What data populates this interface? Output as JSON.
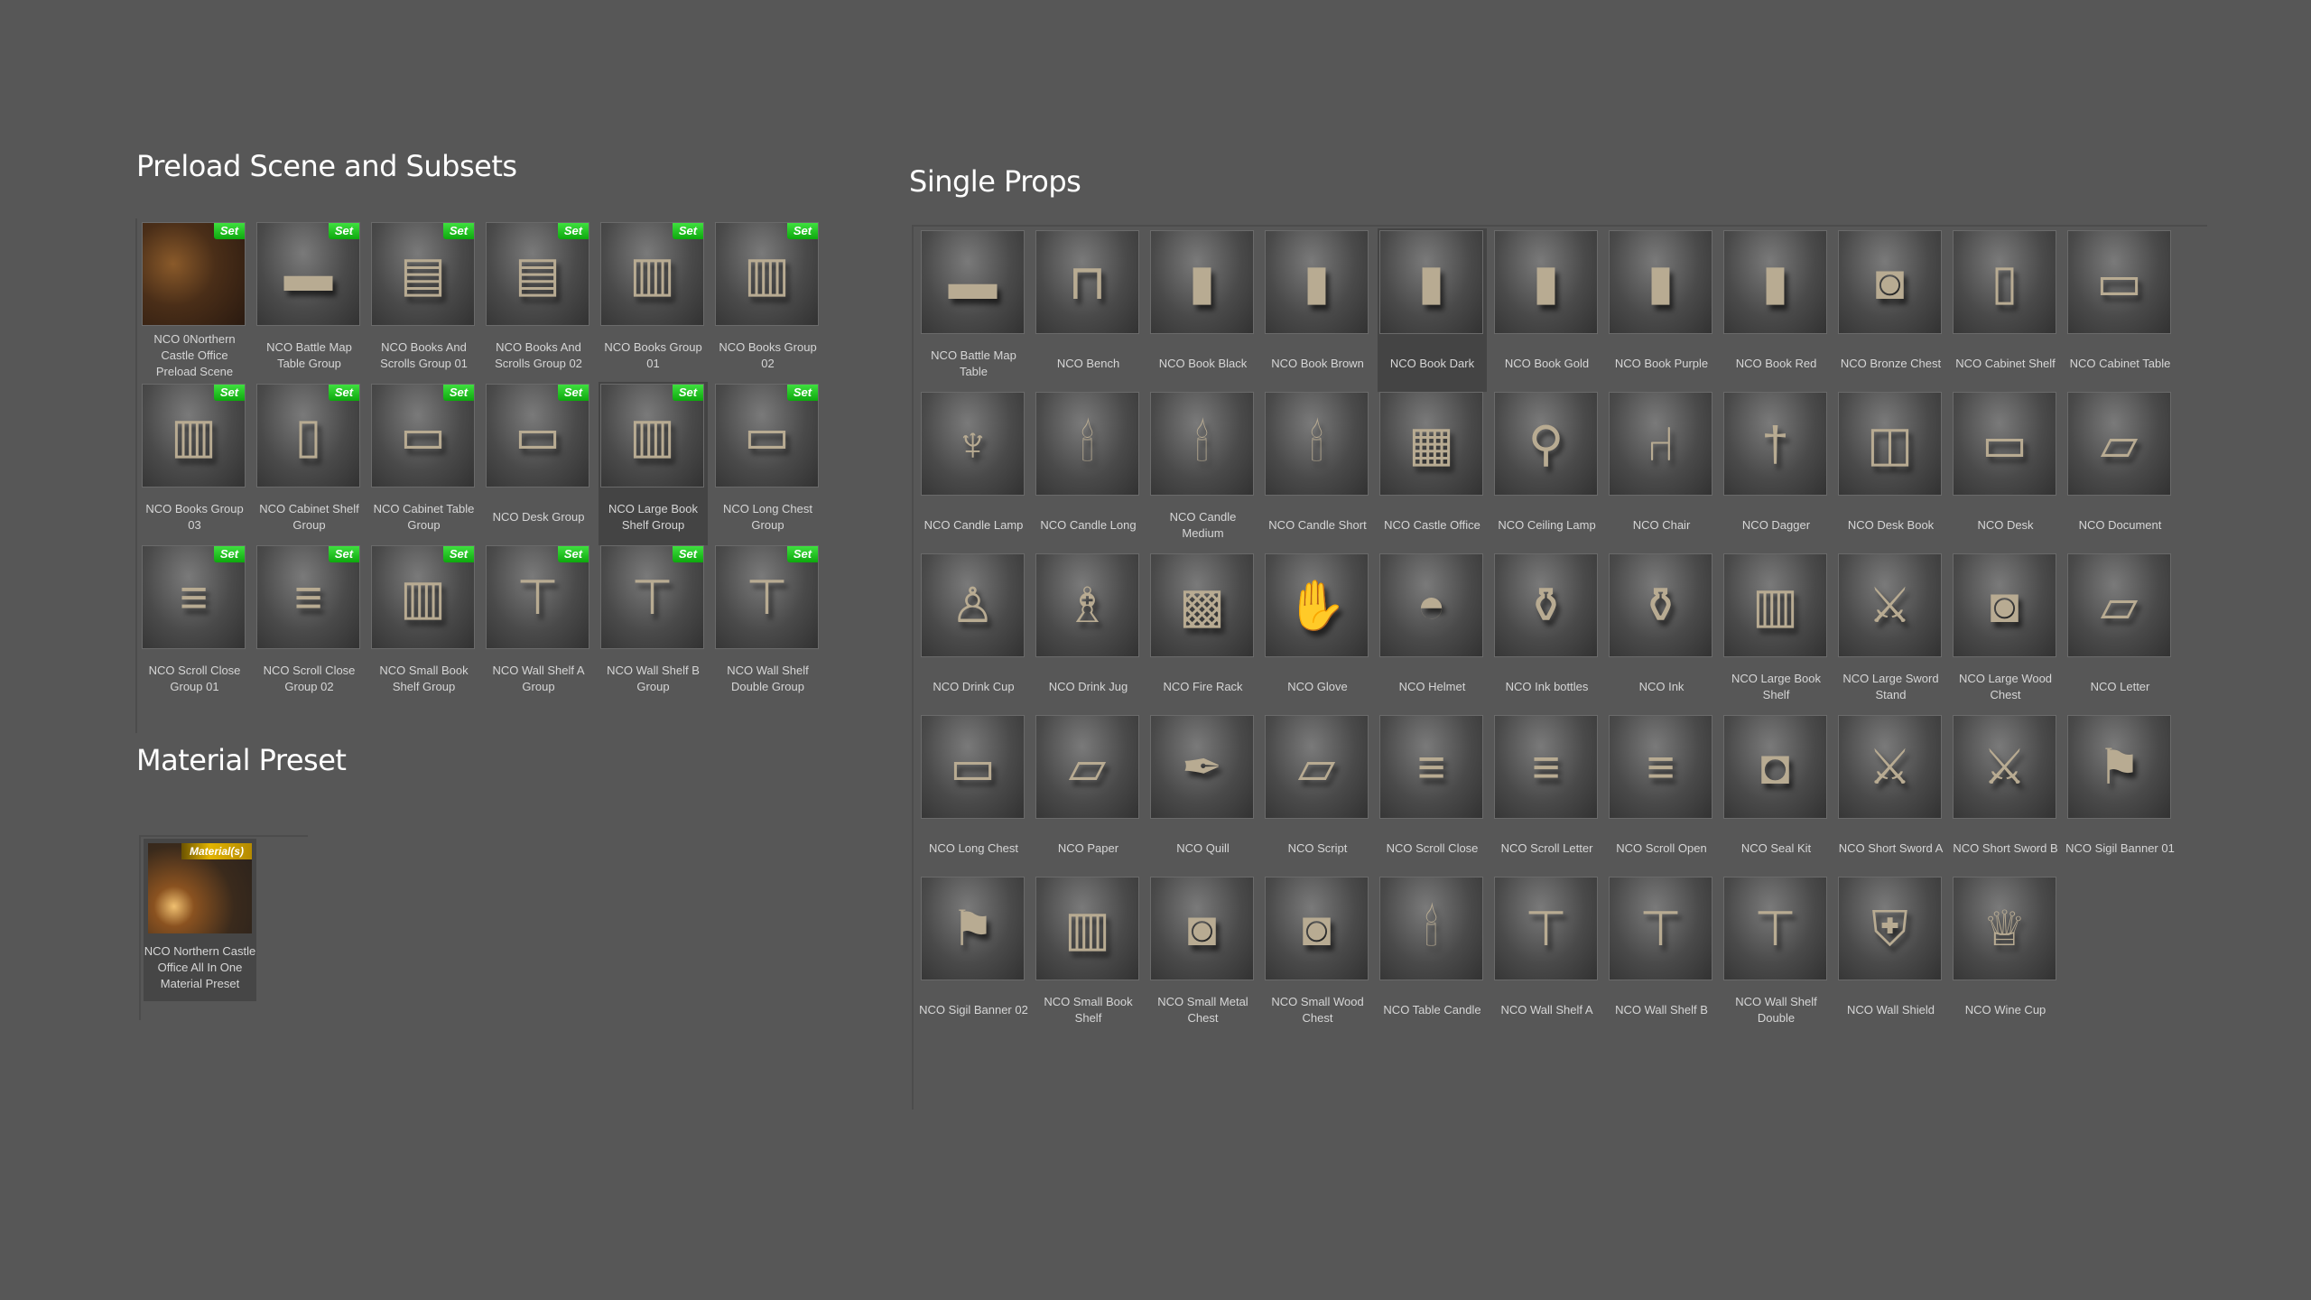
{
  "sections": {
    "preload": {
      "title": "Preload Scene and Subsets",
      "badge": "Set",
      "items": [
        {
          "label": "NCO 0Northern Castle Office Preload Scene",
          "icon": "castle-office-scene-icon"
        },
        {
          "label": "NCO Battle Map Table Group",
          "icon": "battle-map-table-icon"
        },
        {
          "label": "NCO Books And Scrolls Group 01",
          "icon": "books-scrolls-icon"
        },
        {
          "label": "NCO Books And Scrolls Group 02",
          "icon": "books-scrolls-icon"
        },
        {
          "label": "NCO Books Group 01",
          "icon": "books-icon"
        },
        {
          "label": "NCO Books Group 02",
          "icon": "books-icon"
        },
        {
          "label": "NCO Books Group 03",
          "icon": "books-icon"
        },
        {
          "label": "NCO Cabinet Shelf Group",
          "icon": "cabinet-shelf-icon"
        },
        {
          "label": "NCO Cabinet Table Group",
          "icon": "cabinet-table-icon"
        },
        {
          "label": "NCO Desk Group",
          "icon": "desk-icon"
        },
        {
          "label": "NCO Large Book Shelf Group",
          "icon": "bookshelf-icon",
          "selected": true
        },
        {
          "label": "NCO Long Chest Group",
          "icon": "long-chest-icon"
        },
        {
          "label": "NCO Scroll Close Group 01",
          "icon": "scrolls-icon"
        },
        {
          "label": "NCO Scroll Close Group 02",
          "icon": "scrolls-icon"
        },
        {
          "label": "NCO Small Book Shelf Group",
          "icon": "bookshelf-icon"
        },
        {
          "label": "NCO Wall Shelf A Group",
          "icon": "wall-shelf-icon"
        },
        {
          "label": "NCO Wall Shelf B Group",
          "icon": "wall-shelf-icon"
        },
        {
          "label": "NCO Wall Shelf Double Group",
          "icon": "wall-shelf-icon"
        }
      ]
    },
    "material": {
      "title": "Material Preset",
      "badge": "Material(s)",
      "items": [
        {
          "label": "NCO Northern Castle Office All In One Material Preset",
          "icon": "material-preset-icon"
        }
      ]
    },
    "single": {
      "title": "Single Props",
      "items": [
        {
          "label": "NCO Battle Map Table",
          "icon": "battle-map-table-icon"
        },
        {
          "label": "NCO Bench",
          "icon": "bench-icon"
        },
        {
          "label": "NCO Book Black",
          "icon": "book-icon"
        },
        {
          "label": "NCO Book Brown",
          "icon": "book-icon"
        },
        {
          "label": "NCO Book Dark",
          "icon": "book-icon",
          "selected": true
        },
        {
          "label": "NCO Book Gold",
          "icon": "book-icon"
        },
        {
          "label": "NCO Book Purple",
          "icon": "book-icon"
        },
        {
          "label": "NCO Book Red",
          "icon": "book-icon"
        },
        {
          "label": "NCO Bronze Chest",
          "icon": "chest-icon"
        },
        {
          "label": "NCO Cabinet Shelf",
          "icon": "cabinet-shelf-icon"
        },
        {
          "label": "NCO Cabinet Table",
          "icon": "cabinet-table-icon"
        },
        {
          "label": "NCO Candle Lamp",
          "icon": "candle-lamp-icon"
        },
        {
          "label": "NCO Candle Long",
          "icon": "candle-icon"
        },
        {
          "label": "NCO Candle Medium",
          "icon": "candle-icon"
        },
        {
          "label": "NCO Candle Short",
          "icon": "candle-icon"
        },
        {
          "label": "NCO Castle Office",
          "icon": "castle-office-icon"
        },
        {
          "label": "NCO Ceiling Lamp",
          "icon": "ceiling-lamp-icon"
        },
        {
          "label": "NCO Chair",
          "icon": "chair-icon"
        },
        {
          "label": "NCO Dagger",
          "icon": "dagger-icon"
        },
        {
          "label": "NCO Desk Book",
          "icon": "open-book-icon"
        },
        {
          "label": "NCO Desk",
          "icon": "desk-icon"
        },
        {
          "label": "NCO Document",
          "icon": "document-icon"
        },
        {
          "label": "NCO Drink Cup",
          "icon": "cup-icon"
        },
        {
          "label": "NCO Drink Jug",
          "icon": "jug-icon"
        },
        {
          "label": "NCO Fire Rack",
          "icon": "fire-rack-icon"
        },
        {
          "label": "NCO Glove",
          "icon": "glove-icon"
        },
        {
          "label": "NCO Helmet",
          "icon": "helmet-icon"
        },
        {
          "label": "NCO Ink bottles",
          "icon": "ink-bottles-icon"
        },
        {
          "label": "NCO Ink",
          "icon": "ink-icon"
        },
        {
          "label": "NCO Large Book Shelf",
          "icon": "bookshelf-icon"
        },
        {
          "label": "NCO Large Sword Stand",
          "icon": "sword-stand-icon"
        },
        {
          "label": "NCO Large Wood Chest",
          "icon": "chest-icon"
        },
        {
          "label": "NCO Letter",
          "icon": "letter-icon"
        },
        {
          "label": "NCO Long Chest",
          "icon": "long-chest-icon"
        },
        {
          "label": "NCO Paper",
          "icon": "paper-icon"
        },
        {
          "label": "NCO Quill",
          "icon": "quill-icon"
        },
        {
          "label": "NCO Script",
          "icon": "script-icon"
        },
        {
          "label": "NCO Scroll Close",
          "icon": "scroll-icon"
        },
        {
          "label": "NCO Scroll Letter",
          "icon": "scroll-icon"
        },
        {
          "label": "NCO Scroll Open",
          "icon": "scroll-icon"
        },
        {
          "label": "NCO Seal Kit",
          "icon": "seal-kit-icon"
        },
        {
          "label": "NCO Short Sword A",
          "icon": "sword-icon"
        },
        {
          "label": "NCO Short Sword B",
          "icon": "sword-icon"
        },
        {
          "label": "NCO Sigil Banner 01",
          "icon": "banner-icon"
        },
        {
          "label": "NCO Sigil Banner 02",
          "icon": "banner-icon"
        },
        {
          "label": "NCO Small Book Shelf",
          "icon": "bookshelf-icon"
        },
        {
          "label": "NCO Small Metal Chest",
          "icon": "chest-icon"
        },
        {
          "label": "NCO Small Wood Chest",
          "icon": "chest-icon"
        },
        {
          "label": "NCO Table Candle",
          "icon": "candle-icon"
        },
        {
          "label": "NCO Wall Shelf A",
          "icon": "wall-shelf-icon"
        },
        {
          "label": "NCO Wall Shelf B",
          "icon": "wall-shelf-icon"
        },
        {
          "label": "NCO Wall Shelf Double",
          "icon": "wall-shelf-icon"
        },
        {
          "label": "NCO Wall Shield",
          "icon": "shield-icon"
        },
        {
          "label": "NCO Wine Cup",
          "icon": "wine-cup-icon"
        }
      ]
    }
  },
  "colors": {
    "background": "#575757",
    "set_badge": "#16c016",
    "material_badge": "#e2b400",
    "label_text": "#d6d6d6"
  }
}
